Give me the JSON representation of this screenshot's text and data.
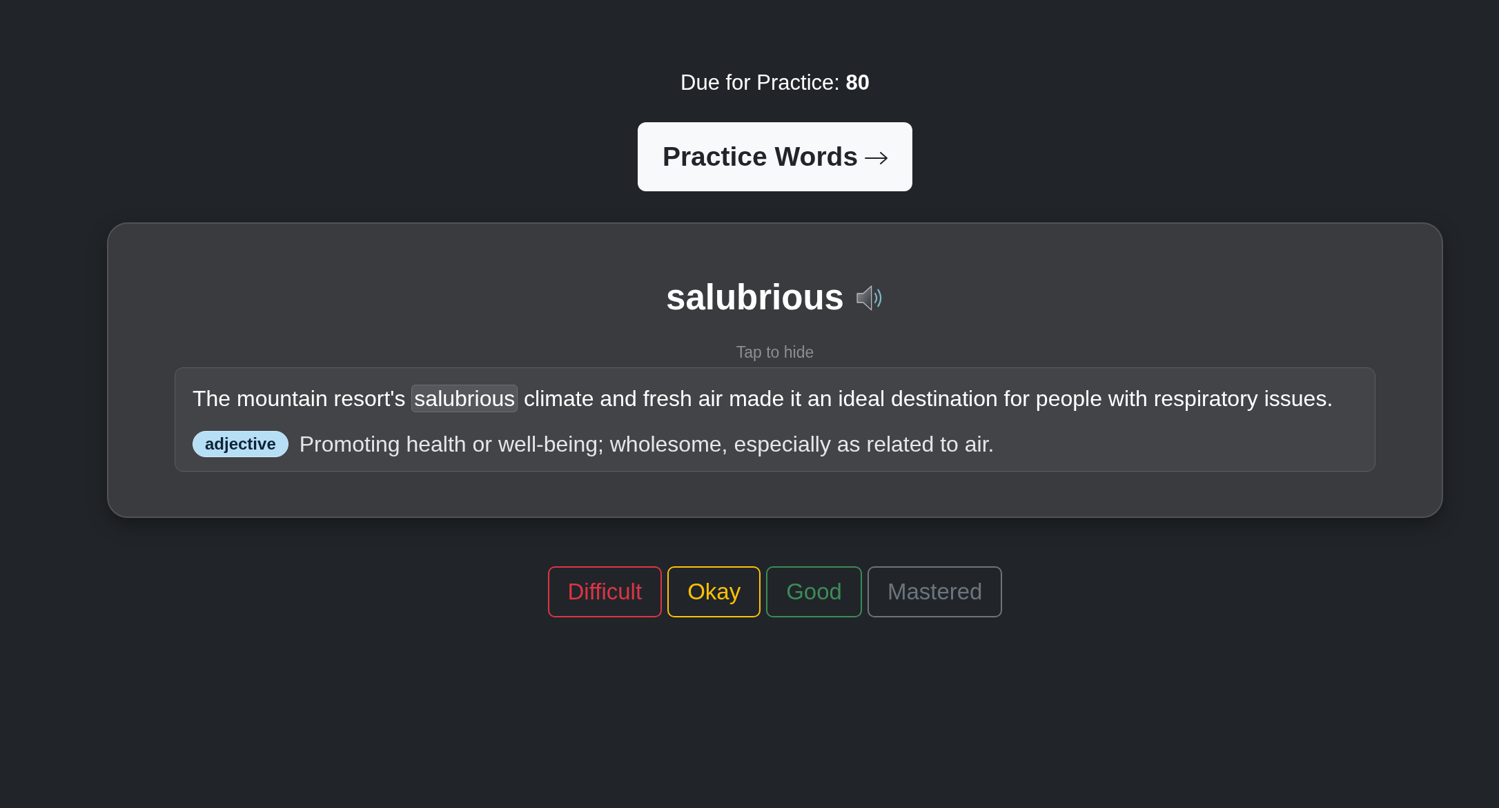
{
  "due_text": "Due for Practice: **80**",
  "practice_button": {
    "label": "Practice Words"
  },
  "card": {
    "word": "salubrious",
    "hint": "Tap to hide",
    "sentence_parts": [
      {
        "text": "The mountain resort's",
        "highlight": false
      },
      {
        "text": "salubrious",
        "highlight": true
      },
      {
        "text": "climate and fresh air made it an ideal destination for people with respiratory issues.",
        "highlight": false
      }
    ],
    "part_of_speech": "adjective",
    "definition": "Promoting health or well-being; wholesome, especially as related to air."
  },
  "ratings": [
    {
      "label": "Difficult",
      "color": "#dc3545"
    },
    {
      "label": "Okay",
      "color": "#ffc107"
    },
    {
      "label": "Good",
      "color": "#3d8b58"
    },
    {
      "label": "Mastered",
      "color": "#6c757d"
    }
  ]
}
